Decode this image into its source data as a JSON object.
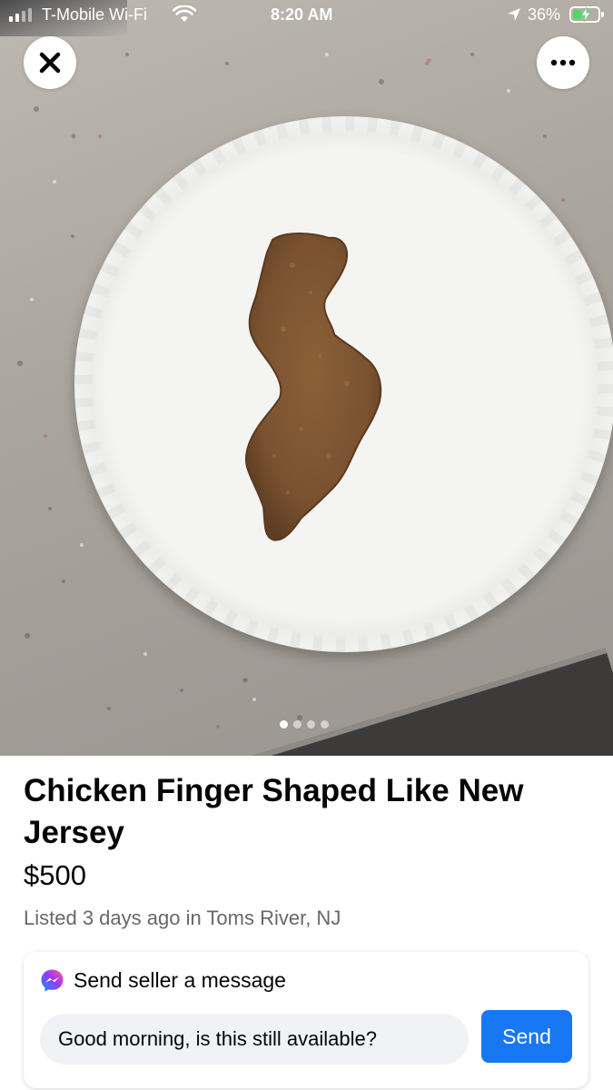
{
  "status_bar": {
    "carrier": "T-Mobile Wi-Fi",
    "time": "8:20 AM",
    "battery_percent": "36%",
    "battery_level": 0.36,
    "charging": true
  },
  "photo": {
    "close_icon": "close-icon",
    "more_icon": "more-options-icon",
    "pagination": {
      "total": 4,
      "current": 1
    }
  },
  "listing": {
    "title": "Chicken Finger Shaped Like New Jersey",
    "price": "$500",
    "listed": "Listed 3 days ago in Toms River, NJ"
  },
  "message": {
    "heading": "Send seller a message",
    "icon": "messenger-icon",
    "input_value": "Good morning, is this still available?",
    "send_label": "Send"
  },
  "colors": {
    "accent": "#1877f2",
    "secondary_text": "#65676b",
    "input_bg": "#f0f2f5"
  }
}
